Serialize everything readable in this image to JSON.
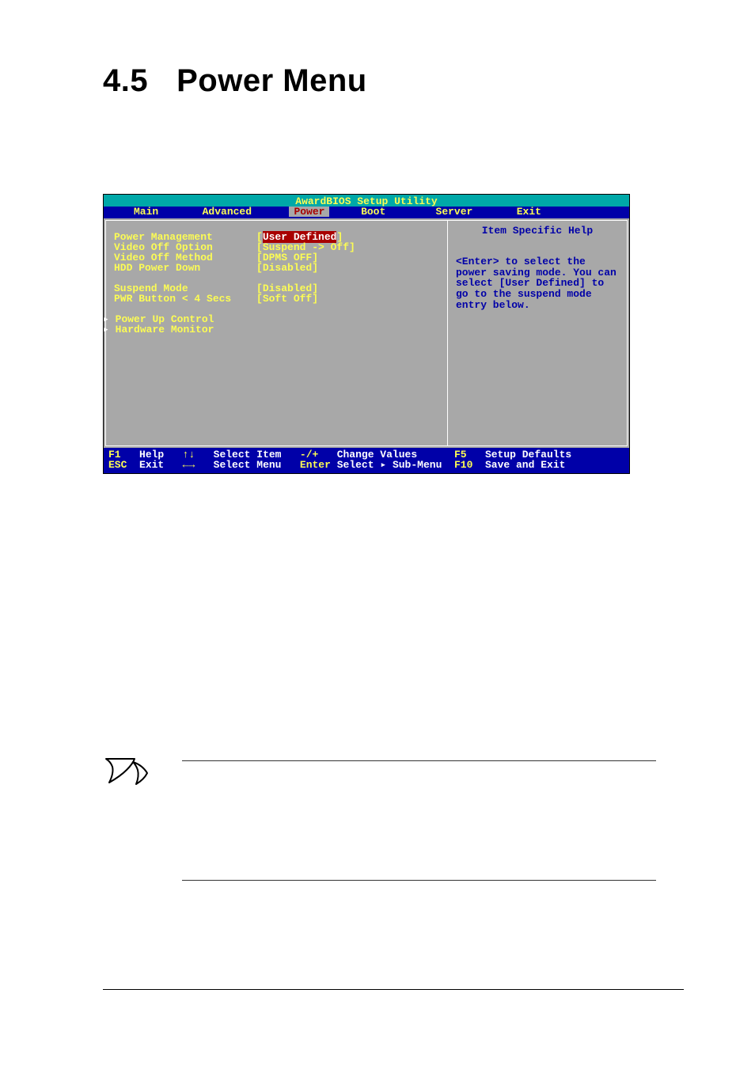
{
  "section": {
    "number": "4.5",
    "title": "Power Menu"
  },
  "bios": {
    "title": "AwardBIOS Setup Utility",
    "tabs": [
      "Main",
      "Advanced",
      "Power",
      "Boot",
      "Server",
      "Exit"
    ],
    "active_tab": "Power",
    "settings": [
      {
        "label": "Power Management",
        "value": "User Defined",
        "selected": true
      },
      {
        "label": "Video Off Option",
        "value": "Suspend -> Off"
      },
      {
        "label": "Video Off Method",
        "value": "DPMS OFF"
      },
      {
        "label": "HDD Power Down",
        "value": "Disabled"
      },
      {
        "label": "",
        "value": ""
      },
      {
        "label": "Suspend Mode",
        "value": "Disabled"
      },
      {
        "label": "PWR Button < 4 Secs",
        "value": "Soft Off"
      }
    ],
    "submenus": [
      "Power Up Control",
      "Hardware Monitor"
    ],
    "help": {
      "header": "Item Specific Help",
      "body": "<Enter> to select the power saving mode. You can select [User Defined] to go to the suspend mode entry below."
    },
    "footer": {
      "row1": {
        "k1": "F1",
        "a1": "Help",
        "s1": "↑↓",
        "a2": "Select Item",
        "k2": "-/+",
        "a3": "Change Values",
        "k3": "F5",
        "a4": "Setup Defaults"
      },
      "row2": {
        "k1": "ESC",
        "a1": "Exit",
        "s1": "←→",
        "a2": "Select Menu",
        "k2": "Enter",
        "a3": "Select ▸ Sub-Menu",
        "k3": "F10",
        "a4": "Save and Exit"
      }
    }
  }
}
